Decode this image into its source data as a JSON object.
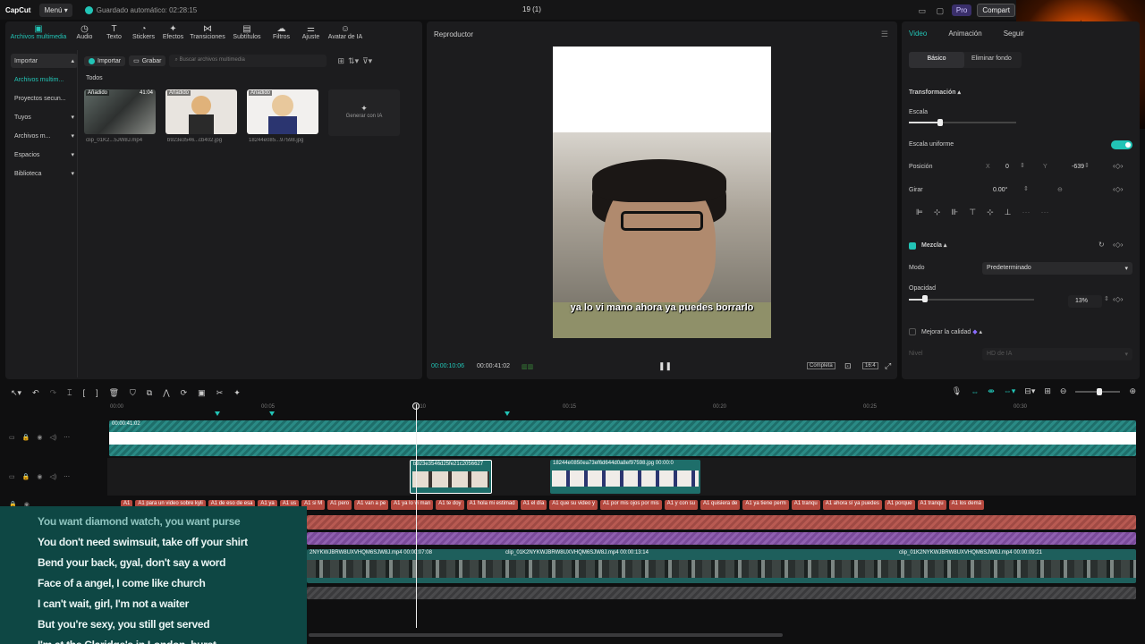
{
  "app": {
    "logo": "CapCut",
    "menu_label": "Menú",
    "autosave": "Guardado automático: 02:28:15",
    "project_title": "19 (1)",
    "pro_label": "Pro",
    "share_label": "Compart"
  },
  "tools": [
    {
      "icon": "media-icon",
      "glyph": "▣",
      "label": "Archivos multimedia"
    },
    {
      "icon": "audio-icon",
      "glyph": "◷",
      "label": "Audio"
    },
    {
      "icon": "text-icon",
      "glyph": "T",
      "label": "Texto"
    },
    {
      "icon": "stickers-icon",
      "glyph": "◔",
      "label": "Stickers"
    },
    {
      "icon": "effects-icon",
      "glyph": "✦",
      "label": "Efectos"
    },
    {
      "icon": "transitions-icon",
      "glyph": "⋈",
      "label": "Transiciones"
    },
    {
      "icon": "subtitles-icon",
      "glyph": "▤",
      "label": "Subtítulos"
    },
    {
      "icon": "filters-icon",
      "glyph": "☁",
      "label": "Filtros"
    },
    {
      "icon": "adjust-icon",
      "glyph": "⚌",
      "label": "Ajuste"
    },
    {
      "icon": "ai-avatar-icon",
      "glyph": "☺",
      "label": "Avatar de IA"
    }
  ],
  "sidebar": [
    {
      "label": "Importar",
      "chevron": "▴"
    },
    {
      "label": "Archivos multim...",
      "chevron": ""
    },
    {
      "label": "Proyectos secun...",
      "chevron": ""
    },
    {
      "label": "Tuyos",
      "chevron": "▾"
    },
    {
      "label": "Archivos m...",
      "chevron": "▾"
    },
    {
      "label": "Espacios",
      "chevron": "▾"
    },
    {
      "label": "Biblioteca",
      "chevron": "▾"
    }
  ],
  "media_toolbar": {
    "import_label": "Importar",
    "record_label": "Grabar",
    "search_placeholder": "Buscar archivos multimedia"
  },
  "media": {
    "section_label": "Todos",
    "items": [
      {
        "badge": "Añadido",
        "duration": "41:04",
        "name": "clip_01K2...5JW8J.mp4"
      },
      {
        "badge": "Añadido",
        "duration": "",
        "name": "b923e3546...cb402.jpg"
      },
      {
        "badge": "Añadido",
        "duration": "",
        "name": "18244e085...97598.jpg"
      }
    ],
    "generate_label": "Generar con IA"
  },
  "player": {
    "title": "Reproductor",
    "subtitle_text": "ya lo vi mano ahora ya puedes borrarlo",
    "current_time": "00:00:10:06",
    "total_time": "00:00:41:02",
    "complete_label": "Completa",
    "ratio_label": "16:4"
  },
  "inspector": {
    "tabs": [
      "Video",
      "Animación",
      "Seguir"
    ],
    "sub_tabs": [
      "Básico",
      "Eliminar fondo"
    ],
    "transform_label": "Transformación",
    "scale_label": "Escala",
    "uniform_scale_label": "Escala uniforme",
    "position_label": "Posición",
    "x_label": "X",
    "x_value": "0",
    "y_label": "Y",
    "y_value": "-639",
    "rotate_label": "Girar",
    "rotate_value": "0.00°",
    "blend_label": "Mezcla",
    "mode_label": "Modo",
    "mode_value": "Predeterminado",
    "opacity_label": "Opacidad",
    "opacity_value": "13%",
    "opacity_fraction": 0.13,
    "enhance_label": "Mejorar la calidad",
    "level_label": "Nivel",
    "level_value": "HD de IA"
  },
  "timeline": {
    "ticks": [
      "00:00",
      "00:05",
      "00:10",
      "00:15",
      "00:20",
      "00:25",
      "00:30"
    ],
    "top_clip_label": "00:00:41:02",
    "image_clip_1": "b923e3546d25fe21c2056627",
    "image_clip_2": "18244e0850ea73ef6d644d0a8ef97598.jpg  00:00:0",
    "video_clips": [
      "2NYKWJBRW8UXVHQM6SJW8J.mp4  00:00:07:08",
      "clip_01K2NYKWJBRW8UXVHQM6SJW8J.mp4  00:00:13:14",
      "clip_01K2NYKWJBRW8UXVHQM6SJW8J.mp4  00:00:09:21"
    ],
    "text_clips": [
      "A1",
      "A1 para un video sobre kyli",
      "A1 de eso de esa",
      "A1 ya",
      "A1 us",
      "A1 si M",
      "A1 pero",
      "A1 van a pe",
      "A1 ya lo vi man",
      "A1 te doy",
      "A1 hola mi estimad",
      "A1 el día",
      "A1 que su video y",
      "A1 por mis ojos por mis",
      "A1 y con su",
      "A1 quisiera de",
      "A1 ya tiene perm",
      "A1 tranqu",
      "A1 ahora sí ya puedes",
      "A1 porque",
      "A1 tranqu",
      "A1 los demá"
    ]
  },
  "lyrics": [
    "You want diamond watch, you want purse",
    "You don't need swimsuit, take off your shirt",
    "Bend your back, gyal, don't say a word",
    "Face of a angel, I come like church",
    "I can't wait, girl, I'm not a waiter",
    "But you're sexy, you still get served",
    "I'm at the Claridge's in London, burst"
  ],
  "colors": {
    "accent": "#22c4b6",
    "text_clip": "#b5493f",
    "lyrics_bg": "#0e4744"
  }
}
